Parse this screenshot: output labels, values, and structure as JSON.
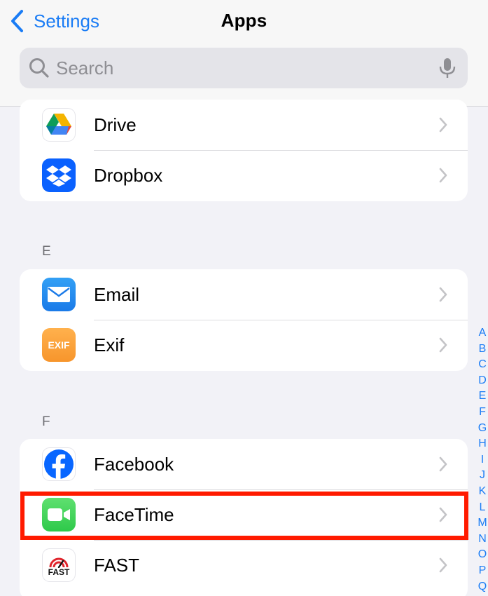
{
  "nav": {
    "back_label": "Settings",
    "title": "Apps"
  },
  "search": {
    "placeholder": "Search"
  },
  "sections": [
    {
      "header": "",
      "items": [
        {
          "label": "Drive",
          "icon": "google-drive-icon"
        },
        {
          "label": "Dropbox",
          "icon": "dropbox-icon"
        }
      ]
    },
    {
      "header": "E",
      "items": [
        {
          "label": "Email",
          "icon": "email-app-icon"
        },
        {
          "label": "Exif",
          "icon": "exif-app-icon",
          "icon_text": "EXIF"
        }
      ]
    },
    {
      "header": "F",
      "items": [
        {
          "label": "Facebook",
          "icon": "facebook-icon"
        },
        {
          "label": "FaceTime",
          "icon": "facetime-icon",
          "highlighted": true
        },
        {
          "label": "FAST",
          "icon": "fast-speedtest-icon",
          "icon_text": "FAST"
        }
      ]
    }
  ],
  "index_letters": [
    "A",
    "B",
    "C",
    "D",
    "E",
    "F",
    "G",
    "H",
    "I",
    "J",
    "K",
    "L",
    "M",
    "N",
    "O",
    "P",
    "Q"
  ],
  "colors": {
    "accent": "#1a7cf5",
    "highlight": "#ff1a00",
    "background": "#f2f2f7"
  }
}
